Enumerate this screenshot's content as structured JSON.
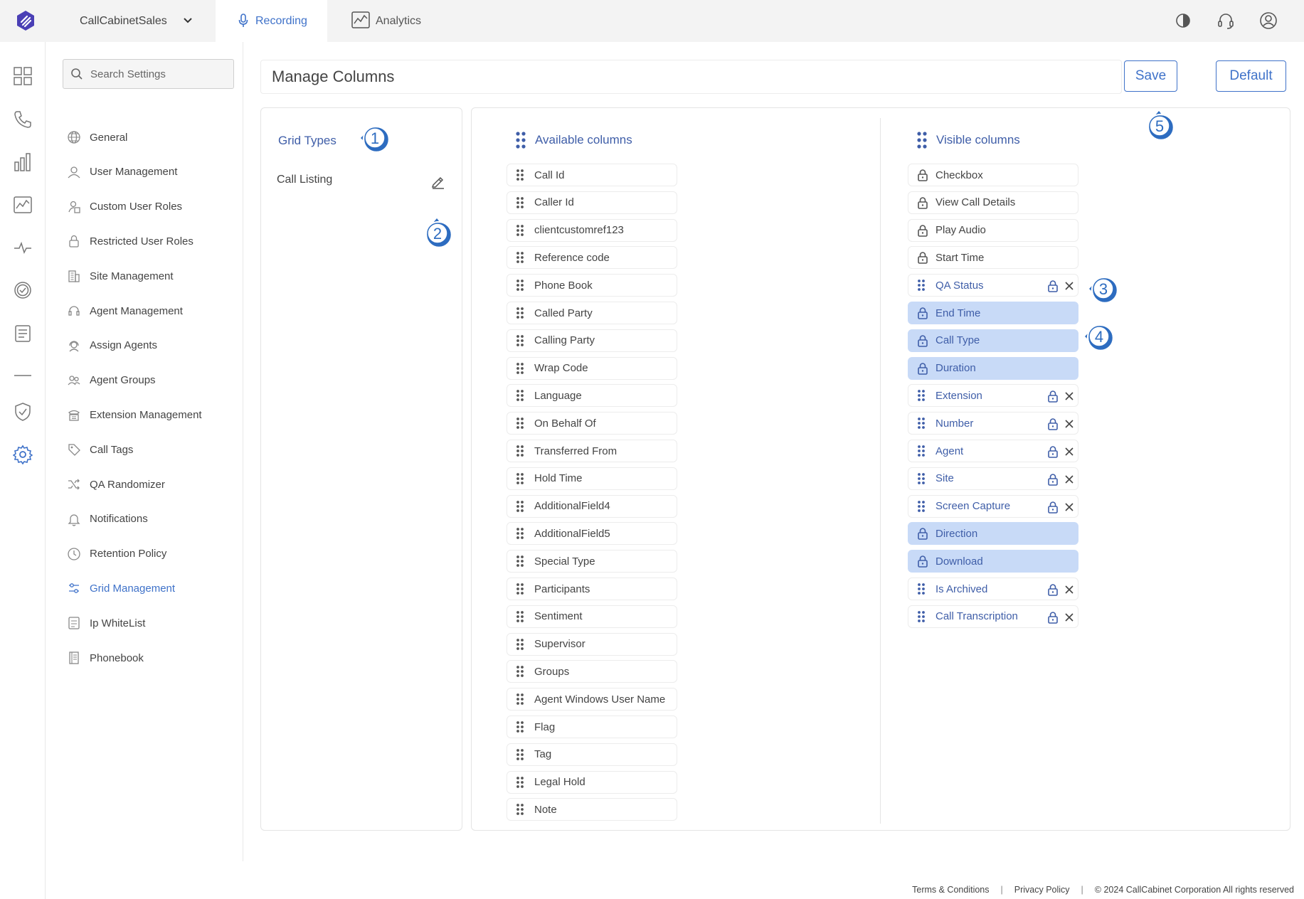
{
  "topbar": {
    "account_name": "CallCabinetSales",
    "tabs": [
      {
        "label": "Recording",
        "active": true
      },
      {
        "label": "Analytics",
        "active": false
      }
    ]
  },
  "nav": {
    "search_placeholder": "Search Settings",
    "items": [
      {
        "label": "General",
        "icon": "globe-icon"
      },
      {
        "label": "User Management",
        "icon": "user-icon"
      },
      {
        "label": "Custom User Roles",
        "icon": "user-badge-icon"
      },
      {
        "label": "Restricted User Roles",
        "icon": "lock-icon"
      },
      {
        "label": "Site Management",
        "icon": "building-icon"
      },
      {
        "label": "Agent Management",
        "icon": "headset-icon"
      },
      {
        "label": "Assign Agents",
        "icon": "headset-user-icon"
      },
      {
        "label": "Agent Groups",
        "icon": "group-icon"
      },
      {
        "label": "Extension Management",
        "icon": "phone-desk-icon"
      },
      {
        "label": "Call Tags",
        "icon": "tag-icon"
      },
      {
        "label": "QA Randomizer",
        "icon": "shuffle-icon"
      },
      {
        "label": "Notifications",
        "icon": "bell-icon"
      },
      {
        "label": "Retention Policy",
        "icon": "clock-icon"
      },
      {
        "label": "Grid Management",
        "icon": "sliders-icon",
        "active": true
      },
      {
        "label": "Ip WhiteList",
        "icon": "list-check-icon"
      },
      {
        "label": "Phonebook",
        "icon": "book-icon"
      }
    ]
  },
  "main": {
    "title": "Manage Columns",
    "save_label": "Save",
    "default_label": "Default",
    "grid_types": {
      "title": "Grid Types",
      "items": [
        "Call Listing"
      ]
    },
    "available": {
      "title": "Available columns",
      "items": [
        "Call Id",
        "Caller Id",
        "clientcustomref123",
        "Reference code",
        "Phone Book",
        "Called Party",
        "Calling Party",
        "Wrap Code",
        "Language",
        "On Behalf Of",
        "Transferred From",
        "Hold Time",
        "AdditionalField4",
        "AdditionalField5",
        "Special Type",
        "Participants",
        "Sentiment",
        "Supervisor",
        "Groups",
        "Agent Windows User Name",
        "Flag",
        "Tag",
        "Legal Hold",
        "Note"
      ]
    },
    "visible": {
      "title": "Visible columns",
      "items": [
        {
          "label": "Checkbox",
          "kind": "fixed"
        },
        {
          "label": "View Call Details",
          "kind": "fixed"
        },
        {
          "label": "Play Audio",
          "kind": "fixed"
        },
        {
          "label": "Start Time",
          "kind": "fixed"
        },
        {
          "label": "QA Status",
          "kind": "removable"
        },
        {
          "label": "End Time",
          "kind": "pinned"
        },
        {
          "label": "Call Type",
          "kind": "pinned"
        },
        {
          "label": "Duration",
          "kind": "pinned"
        },
        {
          "label": "Extension",
          "kind": "removable"
        },
        {
          "label": "Number",
          "kind": "removable"
        },
        {
          "label": "Agent",
          "kind": "removable"
        },
        {
          "label": "Site",
          "kind": "removable"
        },
        {
          "label": "Screen Capture",
          "kind": "removable"
        },
        {
          "label": "Direction",
          "kind": "pinned"
        },
        {
          "label": "Download",
          "kind": "pinned"
        },
        {
          "label": "Is Archived",
          "kind": "removable"
        },
        {
          "label": "Call Transcription",
          "kind": "removable"
        }
      ]
    }
  },
  "callouts": [
    "1",
    "2",
    "3",
    "4",
    "5"
  ],
  "footer": {
    "terms": "Terms & Conditions",
    "privacy": "Privacy Policy",
    "copyright": "© 2024 CallCabinet Corporation All rights reserved"
  },
  "colors": {
    "accent": "#3f72c9",
    "heading": "#3f5ea8",
    "pinned_bg": "#c8daf7",
    "callout": "#2d6cc0"
  }
}
